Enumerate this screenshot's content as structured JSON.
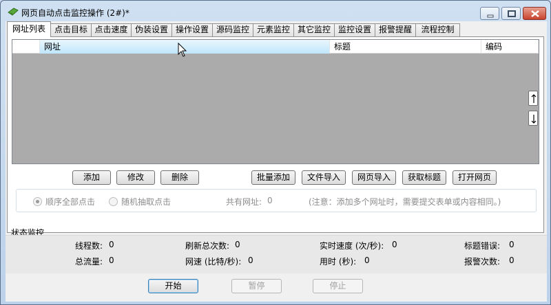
{
  "window": {
    "title": "网页自动点击监控操作  (2#)*"
  },
  "tabs": [
    {
      "label": "网址列表",
      "active": true
    },
    {
      "label": "点击目标"
    },
    {
      "label": "点击速度"
    },
    {
      "label": "伪装设置"
    },
    {
      "label": "操作设置"
    },
    {
      "label": "源码监控"
    },
    {
      "label": "元素监控"
    },
    {
      "label": "其它监控"
    },
    {
      "label": "监控设置"
    },
    {
      "label": "报警提醒"
    },
    {
      "label": "流程控制"
    }
  ],
  "url_list": {
    "columns": [
      "网址",
      "标题",
      "编码"
    ],
    "rows": []
  },
  "list_buttons": {
    "add": "添加",
    "edit": "修改",
    "delete": "删除",
    "batch_add": "批量添加",
    "file_import": "文件导入",
    "web_import": "网页导入",
    "get_title": "获取标题",
    "open_page": "打开网页"
  },
  "mode": {
    "sequential": "顺序全部点击",
    "random": "随机抽取点击",
    "total_label": "共有网址:",
    "total_value": "0",
    "note": "(注意：添加多个网址时，需要提交表单或内容相同。)"
  },
  "status": {
    "section_label": "状态监控",
    "threads_label": "线程数:",
    "threads_value": "0",
    "refresh_label": "刷新总次数:",
    "refresh_value": "0",
    "speed_label": "实时速度 (次/秒):",
    "speed_value": "0",
    "title_err_label": "标题错误:",
    "title_err_value": "0",
    "traffic_label": "总流量:",
    "traffic_value": "0",
    "netspeed_label": "网速 (比特/秒):",
    "netspeed_value": "0",
    "elapsed_label": "用时 (秒):",
    "elapsed_value": "0",
    "alarm_label": "报警次数:",
    "alarm_value": "0"
  },
  "controls": {
    "start": "开始",
    "pause": "暂停",
    "stop": "停止"
  }
}
